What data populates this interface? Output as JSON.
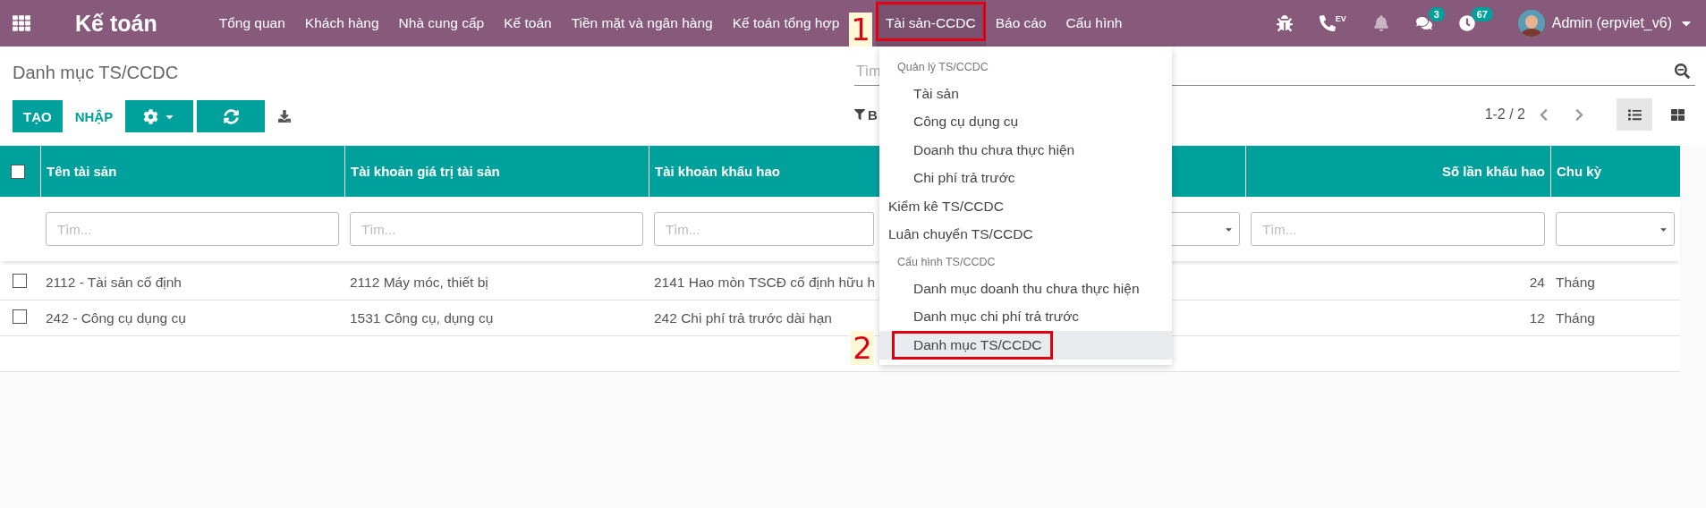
{
  "navbar": {
    "app_title": "Kế toán",
    "menus": [
      {
        "label": "Tổng quan",
        "selected": false
      },
      {
        "label": "Khách hàng",
        "selected": false
      },
      {
        "label": "Nhà cung cấp",
        "selected": false
      },
      {
        "label": "Kế toán",
        "selected": false
      },
      {
        "label": "Tiền mặt và ngân hàng",
        "selected": false
      },
      {
        "label": "Kế toán tổng hợp",
        "selected": false
      },
      {
        "label": "Tài sản-CCDC",
        "selected": true,
        "annotation": "1"
      },
      {
        "label": "Báo cáo",
        "selected": false
      },
      {
        "label": "Cấu hình",
        "selected": false
      }
    ],
    "systray": [
      {
        "kind": "bug"
      },
      {
        "kind": "phone",
        "label": "EV"
      },
      {
        "kind": "bell"
      },
      {
        "kind": "chat",
        "badge": "3"
      },
      {
        "kind": "clock",
        "badge": "67"
      }
    ],
    "user": "Admin (erpviet_v6)"
  },
  "dropdown": [
    {
      "kind": "header",
      "label": "Quản lý TS/CCDC"
    },
    {
      "kind": "subitem",
      "label": "Tài sản",
      "selected": false
    },
    {
      "kind": "subitem",
      "label": "Công cụ dụng cụ",
      "selected": false
    },
    {
      "kind": "subitem",
      "label": "Doanh thu chưa thực hiện",
      "selected": false
    },
    {
      "kind": "subitem",
      "label": "Chi phí trả trước",
      "selected": false
    },
    {
      "kind": "item",
      "label": "Kiểm kê TS/CCDC",
      "selected": false
    },
    {
      "kind": "item",
      "label": "Luân chuyển TS/CCDC",
      "selected": false
    },
    {
      "kind": "header",
      "label": "Cấu hình TS/CCDC"
    },
    {
      "kind": "subitem",
      "label": "Danh mục doanh thu chưa thực hiện",
      "selected": false
    },
    {
      "kind": "subitem",
      "label": "Danh mục chi phí trả trước",
      "selected": false
    },
    {
      "kind": "subitem",
      "label": "Danh mục TS/CCDC",
      "selected": true,
      "annotation": "2"
    }
  ],
  "control_panel": {
    "breadcrumb": "Danh mục TS/CCDC",
    "search": {
      "placeholder": "Tìm"
    },
    "buttons": [
      {
        "kind": "primary",
        "label": "TẠO"
      },
      {
        "kind": "link",
        "label": "NHẬP"
      },
      {
        "kind": "gear"
      },
      {
        "kind": "refresh"
      },
      {
        "kind": "download"
      }
    ],
    "filter_label": "B",
    "pager": "1-2 / 2",
    "views": [
      {
        "kind": "list",
        "selected": true
      },
      {
        "kind": "kanban",
        "selected": false
      }
    ]
  },
  "table": {
    "select_all": {
      "checked": false
    },
    "columns": [
      {
        "label": "Tên tài sản",
        "kind": "text",
        "placeholder": "Tìm..."
      },
      {
        "label": "Tài khoản giá trị tài sản",
        "kind": "text",
        "placeholder": "Tìm..."
      },
      {
        "label": "Tài khoản khấu hao",
        "kind": "text",
        "placeholder": "Tìm..."
      },
      {
        "kind": "select"
      },
      {
        "label": "Số lần khấu hao",
        "kind": "number",
        "placeholder": "Tìm..."
      },
      {
        "label": "Chu kỳ",
        "kind": "select"
      }
    ],
    "rows": [
      {
        "checked": false,
        "cells": [
          "2112 - Tài sản cố định",
          "2112 Máy móc, thiết bị",
          "2141 Hao mòn TSCĐ cố định hữu h",
          null,
          "24",
          "Tháng"
        ]
      },
      {
        "checked": false,
        "cells": [
          "242 - Công cụ dụng cụ",
          "1531 Công cụ, dụng cụ",
          "242 Chi phí trả trước dài hạn",
          null,
          "12",
          "Tháng"
        ]
      }
    ]
  }
}
